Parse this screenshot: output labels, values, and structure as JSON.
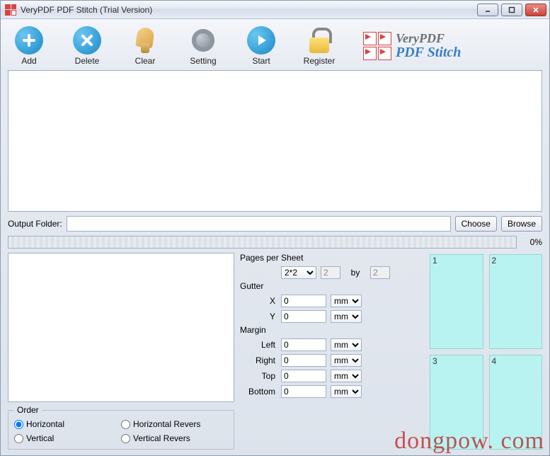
{
  "window": {
    "title": "VeryPDF PDF Stitch (Trial Version)"
  },
  "toolbar": {
    "add": "Add",
    "delete": "Delete",
    "clear": "Clear",
    "setting": "Setting",
    "start": "Start",
    "register": "Register"
  },
  "brand": {
    "line1": "VeryPDF",
    "line2": "PDF Stitch"
  },
  "output": {
    "label": "Output Folder:",
    "value": "",
    "choose": "Choose",
    "browse": "Browse"
  },
  "progress": {
    "percent": "0%"
  },
  "order": {
    "legend": "Order",
    "horizontal": "Horizontal",
    "horizontal_rev": "Horizontal Revers",
    "vertical": "Vertical",
    "vertical_rev": "Vertical Revers",
    "selected": "horizontal"
  },
  "settings": {
    "pages_per_sheet_label": "Pages per Sheet",
    "pages_per_sheet_value": "2*2",
    "by": "by",
    "cols": "2",
    "rows": "2",
    "gutter_label": "Gutter",
    "gutter_x_label": "X",
    "gutter_y_label": "Y",
    "gutter_x": "0",
    "gutter_y": "0",
    "margin_label": "Margin",
    "margin_left_label": "Left",
    "margin_right_label": "Right",
    "margin_top_label": "Top",
    "margin_bottom_label": "Bottom",
    "margin_left": "0",
    "margin_right": "0",
    "margin_top": "0",
    "margin_bottom": "0",
    "unit": "mm"
  },
  "preview_cells": [
    "1",
    "2",
    "3",
    "4"
  ],
  "watermark": "dongpow. com"
}
